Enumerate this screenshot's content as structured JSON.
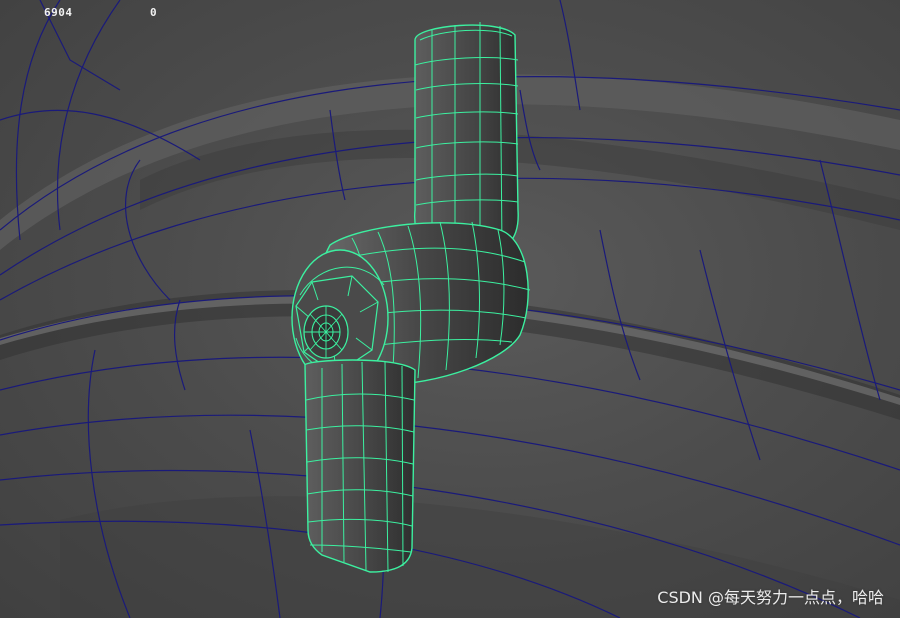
{
  "viewport": {
    "poly_count": "6904",
    "selection_count": "0"
  },
  "watermark": "CSDN @每天努力一点点，哈哈",
  "colors": {
    "background": "#4d4d4d",
    "ground_wire": "#1a1a7a",
    "selected_wire": "#3cf0a0",
    "model_shade": "#454545"
  }
}
